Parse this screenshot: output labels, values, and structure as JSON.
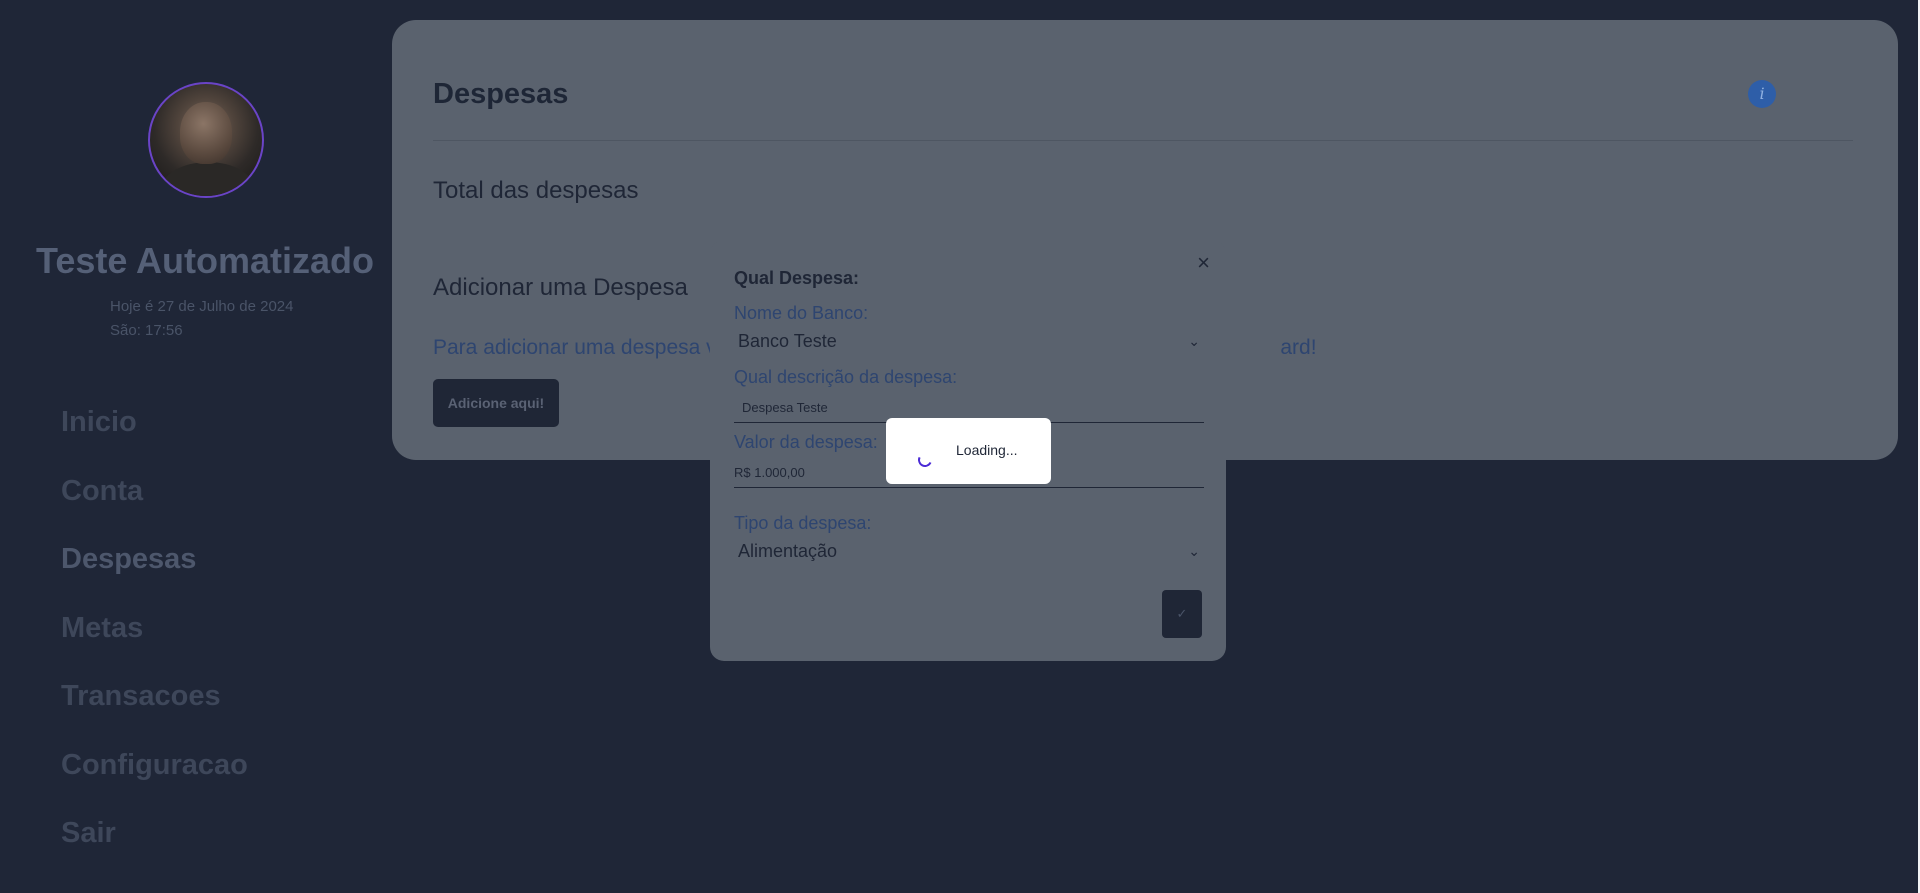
{
  "sidebar": {
    "user_name": "Teste Automatizado",
    "date_text": "Hoje é 27 de Julho de 2024",
    "time_text": "São: 17:56",
    "nav": [
      {
        "label": "Inicio"
      },
      {
        "label": "Conta"
      },
      {
        "label": "Despesas"
      },
      {
        "label": "Metas"
      },
      {
        "label": "Transacoes"
      },
      {
        "label": "Configuracao"
      },
      {
        "label": "Sair"
      }
    ]
  },
  "main": {
    "title": "Despesas",
    "info_icon": "i",
    "total_label": "Total das despesas",
    "add_title": "Adicionar uma Despesa",
    "add_help": "Para adicionar uma despesa vo",
    "add_help_tail": "ard!",
    "add_button": "Adicione aqui!"
  },
  "modal": {
    "close": "×",
    "heading": "Qual Despesa:",
    "bank_label": "Nome do Banco:",
    "bank_value": "Banco Teste",
    "desc_label": "Qual descrição da despesa:",
    "desc_value": "Despesa Teste",
    "amount_label": "Valor da despesa:",
    "amount_value": "R$ 1.000,00",
    "type_label": "Tipo da despesa:",
    "type_value": "Alimentação",
    "confirm_icon": "✓"
  },
  "loading": {
    "text": "Loading..."
  },
  "colors": {
    "background": "#1f2637",
    "overlay_card": "#5a626e",
    "avatar_ring": "#6a44c7",
    "info_icon": "#2e5ea8",
    "spinner": "#4b2bd6"
  }
}
